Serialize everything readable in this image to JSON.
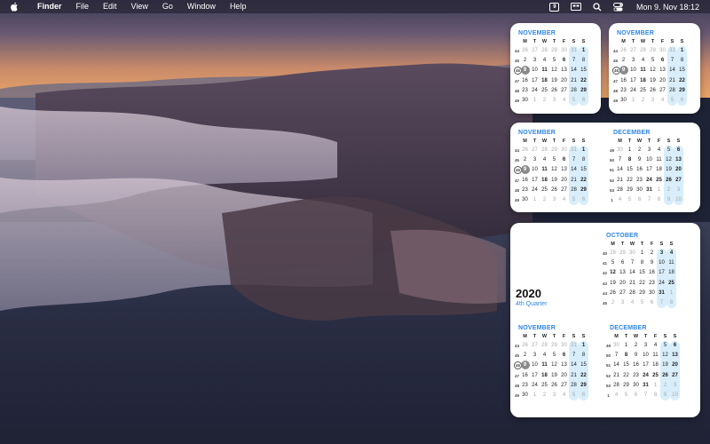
{
  "menubar": {
    "app_name": "Finder",
    "menus": [
      "File",
      "Edit",
      "View",
      "Go",
      "Window",
      "Help"
    ],
    "status_calendar_day": "9",
    "clock": "Mon 9. Nov  18:12"
  },
  "large_widget": {
    "year": "2020",
    "quarter": "4th Quarter"
  },
  "months": {
    "november": {
      "title": "NOVEMBER",
      "headers": [
        "M",
        "T",
        "W",
        "T",
        "F",
        "S",
        "S"
      ],
      "weeks": [
        {
          "wk": "44",
          "days": [
            "26",
            "27",
            "28",
            "29",
            "30",
            "31",
            "1"
          ],
          "dim": [
            0,
            1,
            2,
            3,
            4,
            5
          ]
        },
        {
          "wk": "45",
          "days": [
            "2",
            "3",
            "4",
            "5",
            "6",
            "7",
            "8"
          ],
          "dim": []
        },
        {
          "wk": "46",
          "days": [
            "9",
            "10",
            "11",
            "12",
            "13",
            "14",
            "15"
          ],
          "dim": [],
          "today": 0
        },
        {
          "wk": "47",
          "days": [
            "16",
            "17",
            "18",
            "19",
            "20",
            "21",
            "22"
          ],
          "dim": []
        },
        {
          "wk": "48",
          "days": [
            "23",
            "24",
            "25",
            "26",
            "27",
            "28",
            "29"
          ],
          "dim": []
        },
        {
          "wk": "49",
          "days": [
            "30",
            "1",
            "2",
            "3",
            "4",
            "5",
            "6"
          ],
          "dim": [
            1,
            2,
            3,
            4,
            5,
            6
          ]
        }
      ]
    },
    "december": {
      "title": "DECEMBER",
      "headers": [
        "M",
        "T",
        "W",
        "T",
        "F",
        "S",
        "S"
      ],
      "weeks": [
        {
          "wk": "49",
          "days": [
            "30",
            "1",
            "2",
            "3",
            "4",
            "5",
            "6"
          ],
          "dim": [
            0
          ]
        },
        {
          "wk": "50",
          "days": [
            "7",
            "8",
            "9",
            "10",
            "11",
            "12",
            "13"
          ],
          "dim": []
        },
        {
          "wk": "51",
          "days": [
            "14",
            "15",
            "16",
            "17",
            "18",
            "19",
            "20"
          ],
          "dim": []
        },
        {
          "wk": "52",
          "days": [
            "21",
            "22",
            "23",
            "24",
            "25",
            "26",
            "27"
          ],
          "dim": []
        },
        {
          "wk": "53",
          "days": [
            "28",
            "29",
            "30",
            "31",
            "1",
            "2",
            "3"
          ],
          "dim": [
            4,
            5,
            6
          ]
        },
        {
          "wk": "1",
          "days": [
            "4",
            "5",
            "6",
            "7",
            "8",
            "9",
            "10"
          ],
          "dim": [
            0,
            1,
            2,
            3,
            4,
            5,
            6
          ]
        }
      ]
    },
    "october": {
      "title": "OCTOBER",
      "headers": [
        "M",
        "T",
        "W",
        "T",
        "F",
        "S",
        "S"
      ],
      "weeks": [
        {
          "wk": "40",
          "days": [
            "28",
            "29",
            "30",
            "1",
            "2",
            "3",
            "4"
          ],
          "dim": [
            0,
            1,
            2
          ]
        },
        {
          "wk": "41",
          "days": [
            "5",
            "6",
            "7",
            "8",
            "9",
            "10",
            "11"
          ],
          "dim": []
        },
        {
          "wk": "42",
          "days": [
            "12",
            "13",
            "14",
            "15",
            "16",
            "17",
            "18"
          ],
          "dim": []
        },
        {
          "wk": "43",
          "days": [
            "19",
            "20",
            "21",
            "22",
            "23",
            "24",
            "25"
          ],
          "dim": []
        },
        {
          "wk": "44",
          "days": [
            "26",
            "27",
            "28",
            "29",
            "30",
            "31",
            "1"
          ],
          "dim": [
            6
          ]
        },
        {
          "wk": "45",
          "days": [
            "2",
            "3",
            "4",
            "5",
            "6",
            "7",
            "8"
          ],
          "dim": [
            0,
            1,
            2,
            3,
            4,
            5,
            6
          ]
        }
      ]
    }
  },
  "highlights": {
    "november_bold": [
      "1",
      "11",
      "18",
      "22",
      "29",
      "6"
    ],
    "december_bold": [
      "6",
      "8",
      "13",
      "20",
      "24",
      "25",
      "26",
      "27",
      "31"
    ],
    "october_bold": [
      "3",
      "4",
      "12",
      "25",
      "31"
    ]
  },
  "colors": {
    "accent": "#2f86e8",
    "weekend_bg": "#d8eefa",
    "today": "#8a8a8a"
  }
}
